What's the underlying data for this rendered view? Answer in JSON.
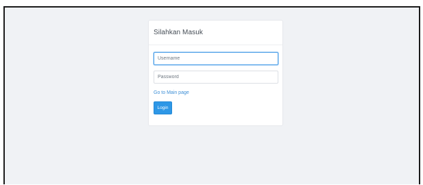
{
  "login": {
    "title": "Silahkan Masuk",
    "username_placeholder": "Username",
    "password_placeholder": "Password",
    "main_page_link": "Go to Main page",
    "login_button": "Login"
  },
  "colors": {
    "background": "#f0f2f5",
    "accent": "#2e97e6",
    "link": "#3d8fd6",
    "focus_border": "#4a9ee8"
  }
}
